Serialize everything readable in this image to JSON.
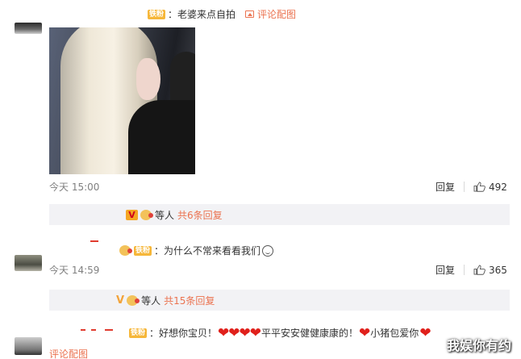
{
  "comment1": {
    "fan_badge": "铁粉",
    "text": "：老婆来点自拍",
    "pic_link": "评论配图",
    "time": "今天 15:00",
    "reply_label": "回复",
    "like_count": "492"
  },
  "reply_box_1": {
    "v_badge": "V",
    "suffix": "等人",
    "more": "共6条回复"
  },
  "comment2": {
    "fan_badge": "铁粉",
    "text": "：为什么不常来看看我们",
    "time": "今天 14:59",
    "reply_label": "回复",
    "like_count": "365"
  },
  "reply_box_2": {
    "v_badge": "V",
    "suffix": "等人",
    "more": "共15条回复"
  },
  "comment3": {
    "fan_badge": "铁粉",
    "text_start": "：好想你宝贝！",
    "text_middle": "平平安安健健康康的！",
    "text_end": "小猪包爱你",
    "pic_link": "评论配图"
  },
  "watermark": "我娱你有约",
  "colors": {
    "accent": "#eb7350",
    "fan_badge_bg": "#f6b73a",
    "reply_bg": "#f2f2f5",
    "heart": "#e0201b"
  }
}
